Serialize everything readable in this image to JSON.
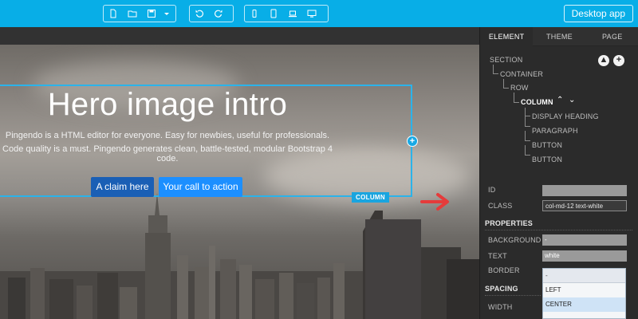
{
  "toolbar": {
    "desktop_app_label": "Desktop app",
    "file_icons": [
      "new-file-icon",
      "open-folder-icon",
      "save-icon",
      "dropdown-caret-icon"
    ],
    "history_icons": [
      "undo-icon",
      "redo-icon"
    ],
    "device_icons": [
      "phone-icon",
      "tablet-icon",
      "laptop-icon",
      "desktop-icon"
    ]
  },
  "hero": {
    "title": "Hero image intro",
    "line1": "Pingendo is a HTML editor for everyone. Easy for newbies, useful for professionals.",
    "line2": "Code quality is a must. Pingendo generates clean, battle-tested, modular Bootstrap 4 code.",
    "btn_claim": "A claim here",
    "btn_cta": "Your call to action",
    "column_tag": "COLUMN",
    "plus_handle": "+"
  },
  "panel": {
    "tabs": [
      "ELEMENT",
      "THEME",
      "PAGE"
    ],
    "tree": {
      "section": "SECTION",
      "container": "CONTAINER",
      "row": "ROW",
      "column": "COLUMN",
      "children": [
        "DISPLAY HEADING",
        "PARAGRAPH",
        "BUTTON",
        "BUTTON"
      ]
    },
    "id_label": "ID",
    "id_value": "",
    "class_label": "CLASS",
    "class_value": "col-md-12 text-white",
    "properties_title": "PROPERTIES",
    "background_label": "BACKGROUND",
    "background_value": "-",
    "text_label": "TEXT",
    "text_value": "white",
    "border_label": "BORDER",
    "spacing_title": "SPACING",
    "width_label": "WIDTH",
    "dropdown_selected": "-",
    "dropdown_options": [
      "LEFT",
      "CENTER"
    ]
  },
  "colors": {
    "toolbar": "#08aee7",
    "panel_bg": "#2b2b2b",
    "selection": "#2bb3ea",
    "primary_dark": "#1a5fb5",
    "primary": "#1c8fff",
    "arrow": "#e53b3b"
  }
}
